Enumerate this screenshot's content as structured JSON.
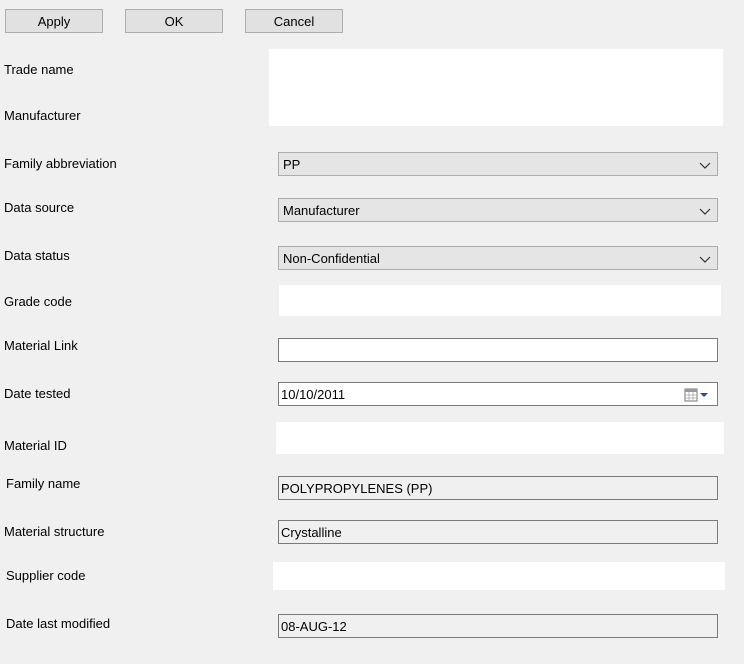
{
  "toolbar": {
    "apply_label": "Apply",
    "ok_label": "OK",
    "cancel_label": "Cancel"
  },
  "labels": {
    "trade_name": "Trade name",
    "manufacturer": "Manufacturer",
    "family_abbreviation": "Family abbreviation",
    "data_source": "Data source",
    "data_status": "Data status",
    "grade_code": "Grade code",
    "material_link": "Material Link",
    "date_tested": "Date tested",
    "material_id": "Material ID",
    "family_name": "Family name",
    "material_structure": "Material structure",
    "supplier_code": "Supplier code",
    "date_last_modified": "Date last modified"
  },
  "fields": {
    "family_abbreviation": "PP",
    "data_source": "Manufacturer",
    "data_status": "Non-Confidential",
    "material_link": "",
    "date_tested": "10/10/2011",
    "family_name": "POLYPROPYLENES (PP)",
    "material_structure": "Crystalline",
    "date_last_modified": "08-AUG-12"
  },
  "icons": {
    "dropdown": "chevron-down-icon",
    "calendar": "calendar-icon"
  }
}
